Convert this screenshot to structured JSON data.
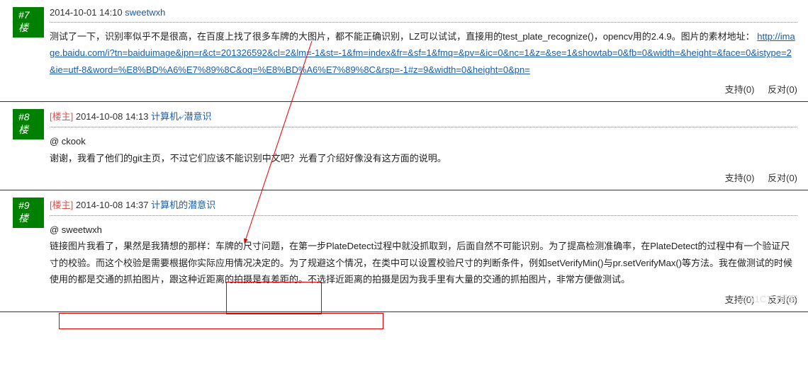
{
  "posts": [
    {
      "floor": "#7楼",
      "owner": false,
      "date": "2014-10-01 14:10",
      "author": "sweetwxh",
      "body_parts": {
        "text1": "测试了一下，识别率似乎不是很高，在百度上找了很多车牌的大图片，都不能正确识别，LZ可以试试，直接用的test_plate_recognize()，opencv用的2.4.9。图片的素材地址：",
        "link_text": "http://image.baidu.com/i?tn=baiduimage&ipn=r&ct=201326592&cl=2&lm=-1&st=-1&fm=index&fr=&sf=1&fmq=&pv=&ic=0&nc=1&z=&se=1&showtab=0&fb=0&width=&height=&face=0&istype=2&ie=utf-8&word=%E8%BD%A6%E7%89%8C&oq=%E8%BD%A6%E7%89%8C&rsp=-1#z=9&width=0&height=0&pn="
      },
      "support": "支持(0)",
      "oppose": "反对(0)"
    },
    {
      "floor": "#8楼",
      "owner": true,
      "owner_label": "楼主",
      "date": "2014-10-08 14:13",
      "author": "计算机的潜意识",
      "mention": "@ ckook",
      "body": "谢谢，我看了他们的git主页，不过它们应该不能识别中文吧？光看了介绍好像没有这方面的说明。",
      "support": "支持(0)",
      "oppose": "反对(0)"
    },
    {
      "floor": "#9楼",
      "owner": true,
      "owner_label": "楼主",
      "date": "2014-10-08 14:37",
      "author": "计算机的潜意识",
      "mention": "@ sweetwxh",
      "body": "链接图片我看了，果然是我猜想的那样：车牌的尺寸问题，在第一步PlateDetect过程中就没抓取到，后面自然不可能识别。为了提高检测准确率，在PlateDetect的过程中有一个验证尺寸的校验。而这个校验是需要根据你实际应用情况决定的。为了规避这个情况，在类中可以设置校验尺寸的判断条件，例如setVerifyMin()与pr.setVerifyMax()等方法。我在做测试的时候使用的都是交通的抓拍图片，跟这种近距离的拍摄是有差距的。不选择近距离的拍摄是因为我手里有大量的交通的抓拍图片，非常方便做测试。",
      "support": "支持(0)",
      "oppose": "反对(0)"
    }
  ],
  "watermark": "@51CTO博客"
}
